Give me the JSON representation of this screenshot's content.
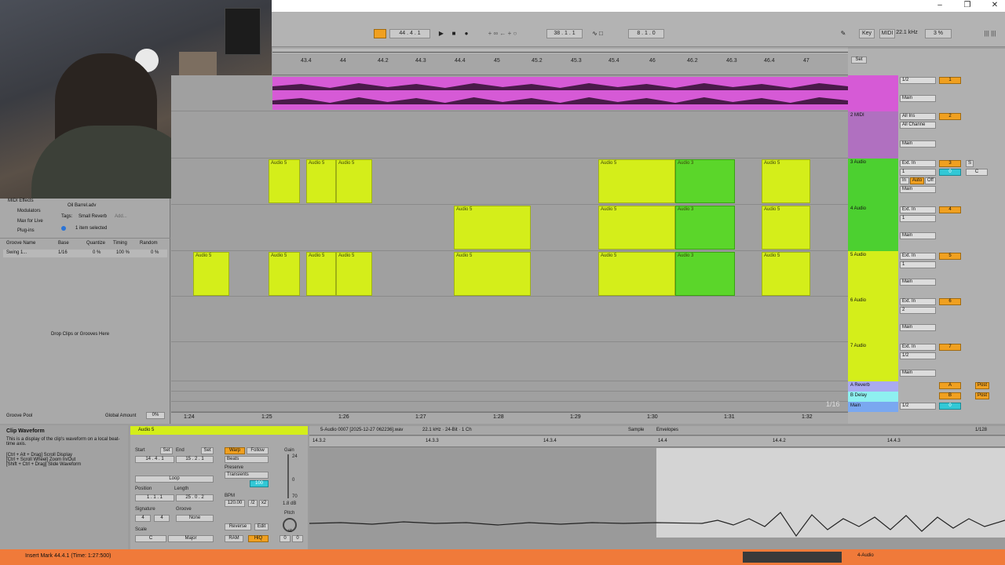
{
  "window": {
    "minimize": "–",
    "restore": "❐",
    "close": "✕"
  },
  "transport": {
    "position": "44 . 4 . 1",
    "loop_start": "38 . 1 . 1",
    "loop_length": "8 . 1 . 0"
  },
  "toolbar_right": {
    "key": "Key",
    "midi": "MIDI",
    "sample_rate": "22.1 kHz",
    "cpu": "3 %"
  },
  "ruler": {
    "ticks": [
      "43.4",
      "44",
      "44.2",
      "44.3",
      "44.4",
      "45",
      "45.2",
      "45.3",
      "45.4",
      "46",
      "46.2",
      "46.3",
      "46.4",
      "47"
    ]
  },
  "time_ruler": {
    "ticks": [
      "1:24",
      "1:25",
      "1:26",
      "1:27",
      "1:28",
      "1:29",
      "1:30",
      "1:31",
      "1:32"
    ]
  },
  "zoom_label": "1/16",
  "browser": {
    "items": [
      "MIDI Effects",
      "Modulators",
      "Max for Live",
      "Plug-ins"
    ],
    "file": "Oil Barrel.adv",
    "tags_label": "Tags:",
    "tag": "Small Reverb",
    "tag_add": "Add...",
    "selected": "1 item selected",
    "groove_headers": [
      "Groove Name",
      "Base",
      "Quantize",
      "Timing",
      "Random"
    ],
    "groove_row": {
      "name": "Swing 1...",
      "base": "1/16",
      "quantize": "0 %",
      "timing": "100 %",
      "random": "0 %"
    },
    "drop_text": "Drop Clips or Grooves Here",
    "groove_pool": "Groove Pool",
    "global_amount_label": "Global Amount",
    "global_amount": "0%"
  },
  "tracks": [
    {
      "name": "",
      "number": "1",
      "input": "1/2",
      "routing": "Main"
    },
    {
      "name": "2 MIDI",
      "number": "2",
      "input": "All Ins",
      "channel": "All Channe",
      "routing": "Main"
    },
    {
      "name": "3 Audio",
      "number": "3",
      "input": "Ext. In",
      "channel": "1",
      "routing": "Main"
    },
    {
      "name": "4 Audio",
      "number": "4",
      "input": "Ext. In",
      "channel": "1",
      "routing": "Main"
    },
    {
      "name": "5 Audio",
      "number": "5",
      "input": "Ext. In",
      "channel": "1",
      "routing": "Main"
    },
    {
      "name": "6 Audio",
      "number": "6",
      "input": "Ext. In",
      "channel": "2",
      "routing": "Main"
    },
    {
      "name": "7 Audio",
      "number": "7",
      "input": "Ext. In",
      "channel": "1/2",
      "routing": "Main"
    }
  ],
  "returns": [
    {
      "name": "A Reverb",
      "letter": "A",
      "post": "Post"
    },
    {
      "name": "B Delay",
      "letter": "B",
      "post": "Post"
    }
  ],
  "main": {
    "name": "Main",
    "output": "1/2",
    "value": "0"
  },
  "monitor": {
    "in": "In",
    "auto": "Auto",
    "off": "Off"
  },
  "mixer_values": {
    "vol": "0",
    "pan": "C",
    "send": "-∞",
    "solo": "S"
  },
  "set_label": "Set",
  "clip_labels": {
    "a5": "Audio 5",
    "a3": "Audio 3"
  },
  "info": {
    "title": "Clip Waveform",
    "text1": "This is a display of the clip's waveform on a local beat-time axis.",
    "text2": "[Ctrl + Alt + Drag] Scroll Display",
    "text3": "[Ctrl + Scroll Wheel] Zoom In/Out",
    "text4": "[Shift + Ctrl + Drag] Slide Waveform"
  },
  "clipview": {
    "name": "Audio 5",
    "start_label": "Start",
    "end_label": "End",
    "set": "Set",
    "start": "14 . 4 . 1",
    "end": "15 . 2 . 1",
    "loop": "Loop",
    "position_label": "Position",
    "length_label": "Length",
    "position": "1 . 1 . 1",
    "length": "25 . 0 . 2",
    "signature_label": "Signature",
    "groove_label": "Groove",
    "sig_num": "4",
    "sig_den": "4",
    "groove": "None",
    "scale_label": "Scale",
    "scale_root": "C",
    "scale_mode": "Major",
    "warp": "Warp",
    "follow": "Follow",
    "beats": "Beats",
    "preserve": "Preserve",
    "transients": "Transients",
    "tr_val": "100",
    "bpm_label": "BPM",
    "bpm": "120.00",
    "half": "/2",
    "double": "x2",
    "reverse": "Reverse",
    "edit": "Edit",
    "ram": "RAM",
    "hiq": "HiQ",
    "gain": "Gain",
    "gain_db": "1.8 dB",
    "g24": "24",
    "g0": "0",
    "g70": "70",
    "pitch": "Pitch",
    "st": "st",
    "pitch_val": "0",
    "cents": "0"
  },
  "sampleview": {
    "file": "5-Audio 0007 [2025-12-27 062236].wav",
    "format": "22.1 kHz · 24-Bit · 1 Ch",
    "tab_sample": "Sample",
    "tab_envelopes": "Envelopes",
    "quant": "1/128",
    "ticks": [
      "14.3.2",
      "14.3.3",
      "14.3.4",
      "14.4",
      "14.4.2",
      "14.4.3"
    ]
  },
  "status": {
    "message": "Insert Mark 44.4.1 (Time: 1:27:500)",
    "track": "4-Audio"
  },
  "colors": {
    "clip": "#d4ee1a",
    "clip_alt": "#5bd62a",
    "track1": "#d65ad6",
    "status": "#f07a3a"
  }
}
